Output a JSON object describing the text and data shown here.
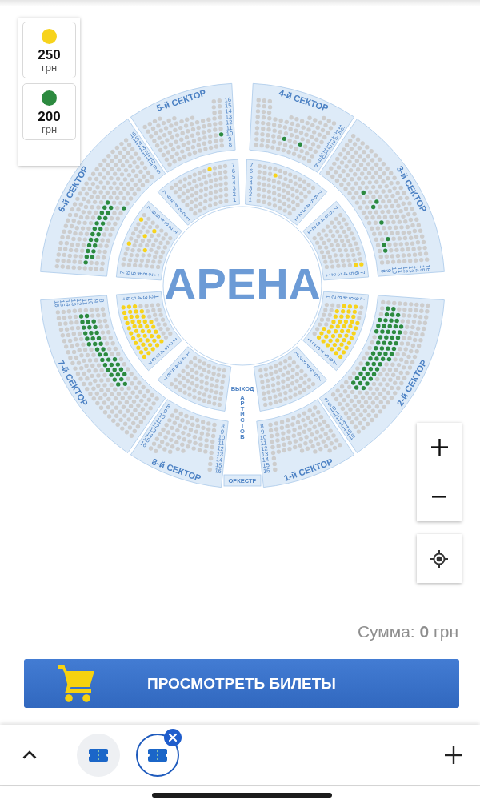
{
  "legend": [
    {
      "price": "250",
      "currency": "грн",
      "color": "#f7d31c"
    },
    {
      "price": "200",
      "currency": "грн",
      "color": "#2c8a3f"
    }
  ],
  "map": {
    "arena_label": "АРЕНА",
    "exit_label": {
      "first_line": "ВЫХОД",
      "second_line": "АРТИСТОВ"
    },
    "orchestra_label": "ОРКЕСТР",
    "inner_blocks": [
      {
        "row_labels_start": [
          "1",
          "2",
          "3",
          "4",
          "5",
          "6",
          "7"
        ],
        "row_labels_end": [
          "1",
          "2",
          "3",
          "4",
          "5",
          "6",
          "7"
        ]
      },
      {
        "row_labels_start": [
          "1",
          "2",
          "3",
          "4",
          "5",
          "6",
          "7"
        ],
        "row_labels_end": [
          "1",
          "2",
          "3",
          "4",
          "5",
          "6",
          "7"
        ]
      },
      {
        "row_labels_start": [
          "1",
          "2",
          "3",
          "4",
          "5",
          "6",
          "7"
        ],
        "row_labels_end": [
          "1",
          "2",
          "3",
          "4",
          "5",
          "6",
          "7"
        ]
      },
      {
        "row_labels_start": [
          "1",
          "2",
          "3",
          "4",
          "5",
          "6",
          "7"
        ],
        "row_labels_end": [
          "1",
          "2",
          "3",
          "4",
          "5",
          "6",
          "7"
        ]
      },
      {
        "row_labels_start": [
          "1",
          "2",
          "3",
          "4",
          "5",
          "6",
          "7"
        ],
        "row_labels_end": [
          "1",
          "2",
          "3",
          "4",
          "5",
          "6",
          "7"
        ]
      },
      {
        "row_labels_start": [
          "1",
          "2",
          "3",
          "4",
          "5",
          "6",
          "7"
        ]
      },
      {
        "row_labels_end": [
          "1",
          "2",
          "3",
          "4",
          "5",
          "6",
          "7"
        ]
      },
      {
        "row_labels_start": [
          "1",
          "2",
          "3",
          "4",
          "5",
          "6",
          "7"
        ],
        "row_labels_end": [
          "1",
          "2",
          "3",
          "4",
          "5",
          "6",
          "7"
        ]
      }
    ],
    "sectors": [
      {
        "name": "1-й СЕКТОР",
        "row_labels_start": [
          "8",
          "9",
          "10",
          "11",
          "12",
          "13",
          "14",
          "15",
          "16"
        ]
      },
      {
        "name": "2-й СЕКТОР",
        "row_labels_start": [
          "8",
          "9",
          "10",
          "11",
          "12",
          "13",
          "14",
          "15",
          "16"
        ]
      },
      {
        "name": "3-й СЕКТОР",
        "row_labels_start": [
          "8",
          "9",
          "10",
          "11",
          "12",
          "13",
          "14",
          "15",
          "16"
        ]
      },
      {
        "name": "4-й СЕКТОР",
        "row_labels_start": [
          "8",
          "9",
          "10",
          "11",
          "12",
          "13",
          "14",
          "15",
          "16"
        ]
      },
      {
        "name": "5-й СЕКТОР",
        "row_labels_start": [
          "8",
          "9",
          "10",
          "11",
          "12",
          "13",
          "14",
          "15",
          "16"
        ]
      },
      {
        "name": "6-й СЕКТОР",
        "row_labels_start": [
          "8",
          "9",
          "10",
          "11",
          "12",
          "13",
          "14",
          "15",
          "16"
        ]
      },
      {
        "name": "7-й СЕКТОР",
        "row_labels_start": [
          "8",
          "9",
          "10",
          "11",
          "12",
          "13",
          "14",
          "15",
          "16"
        ]
      },
      {
        "name": "8-й СЕКТОР",
        "row_labels_start": [
          "8",
          "9",
          "10",
          "11",
          "12",
          "13",
          "14",
          "15",
          "16"
        ],
        "row_labels_end": [
          "8",
          "9",
          "10",
          "11",
          "12",
          "13",
          "14",
          "15",
          "16"
        ]
      }
    ]
  },
  "total": "Сумма: **0** грн",
  "view_tickets_button": "ПРОСМОТРЕТЬ БИЛЕТЫ",
  "tab_strip": {
    "tabs": [
      {
        "selected": false
      },
      {
        "selected": true
      }
    ]
  }
}
